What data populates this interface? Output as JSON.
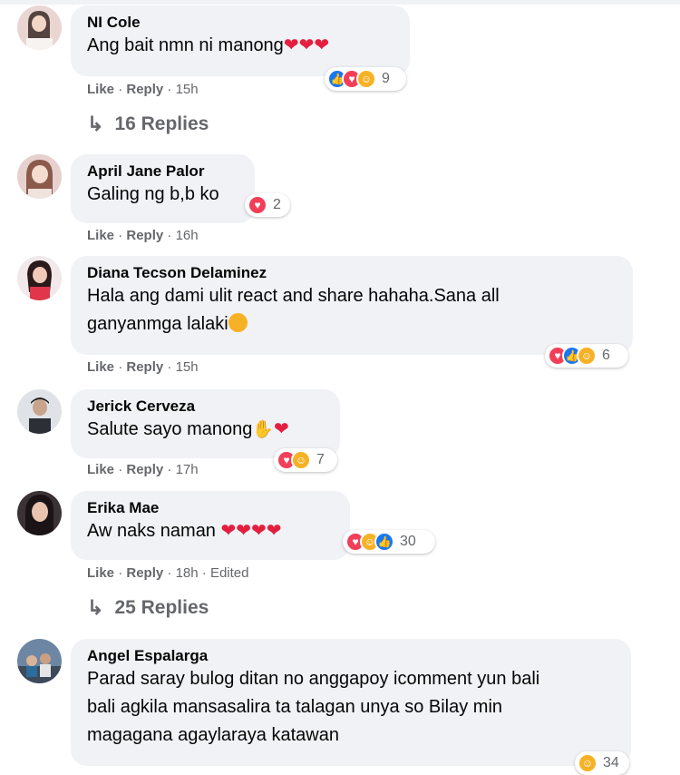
{
  "comments": [
    {
      "author": "NI Cole",
      "text": "Ang bait nmn ni manong",
      "trail": "❤❤❤",
      "like": "Like",
      "reply": "Reply",
      "time": "15h",
      "reaction_count": "9",
      "reactions": [
        "like-icon",
        "love-icon",
        "care-icon"
      ]
    },
    {
      "author": "April Jane Palor",
      "text": "Galing ng b,b ko",
      "like": "Like",
      "reply": "Reply",
      "time": "16h",
      "reaction_count": "2",
      "reactions": [
        "love-icon"
      ]
    },
    {
      "author": "Diana Tecson Delaminez",
      "text": "Hala ang dami ulit react and share hahaha.Sana all",
      "text2": "ganyanmga lalaki",
      "like": "Like",
      "reply": "Reply",
      "time": "15h",
      "reaction_count": "6",
      "reactions": [
        "love-icon",
        "like-icon",
        "care-icon"
      ]
    },
    {
      "author": "Jerick Cerveza",
      "text": "Salute sayo manong",
      "like": "Like",
      "reply": "Reply",
      "time": "17h",
      "reaction_count": "7",
      "reactions": [
        "love-icon",
        "care-icon"
      ]
    },
    {
      "author": "Erika Mae",
      "text": "Aw naks naman",
      "trail": "❤❤❤❤",
      "like": "Like",
      "reply": "Reply",
      "time": "18h",
      "edited": "Edited",
      "reaction_count": "30",
      "reactions": [
        "love-icon",
        "haha-icon",
        "like-icon"
      ]
    },
    {
      "author": "Angel Espalarga",
      "text": "Parad saray bulog ditan no anggapoy icomment yun bali",
      "text2": "bali agkila mansasalira ta talagan unya so Bilay min",
      "text3": "magagana agaylaraya katawan",
      "reaction_count": "34"
    }
  ],
  "replies": [
    {
      "label": "16 Replies"
    },
    {
      "label": "25 Replies"
    }
  ],
  "separator": "·",
  "colors": {
    "bubble": "#f0f2f5",
    "meta": "#65676b",
    "like_blue": "#1877f2",
    "love_red": "#f33e58",
    "care_yellow": "#f7b125"
  }
}
